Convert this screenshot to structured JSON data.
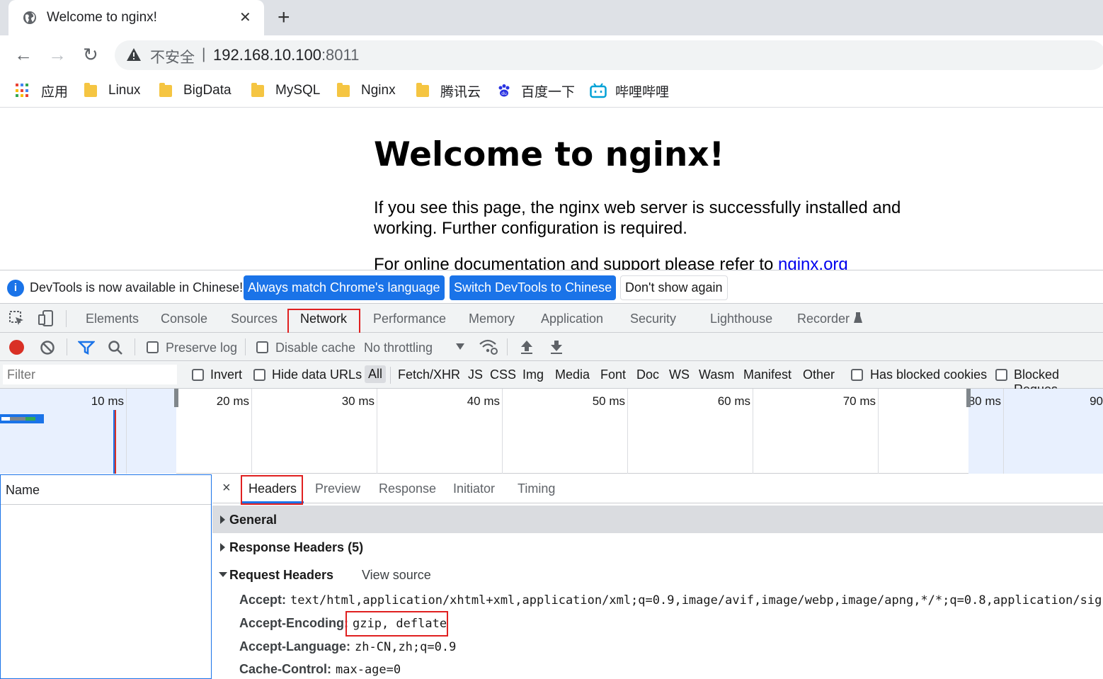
{
  "browser": {
    "tab_title": "Welcome to nginx!",
    "close_glyph": "✕",
    "newtab_glyph": "+",
    "back_glyph": "←",
    "forward_glyph": "→",
    "reload_glyph": "↻",
    "security_label": "不安全",
    "separator": "|",
    "url_host": "192.168.10.100",
    "url_port": ":8011"
  },
  "bookmarks": [
    {
      "label": "应用",
      "icon": "apps-grid-icon"
    },
    {
      "label": "Linux",
      "icon": "folder-icon"
    },
    {
      "label": "BigData",
      "icon": "folder-icon"
    },
    {
      "label": "MySQL",
      "icon": "folder-icon"
    },
    {
      "label": "Nginx",
      "icon": "folder-icon"
    },
    {
      "label": "腾讯云",
      "icon": "folder-icon"
    },
    {
      "label": "百度一下",
      "icon": "baidu-paw-icon"
    },
    {
      "label": "哔哩哔哩",
      "icon": "bilibili-tv-icon"
    }
  ],
  "page": {
    "heading": "Welcome to nginx!",
    "para1": "If you see this page, the nginx web server is successfully installed and working. Further configuration is required.",
    "para2_prefix": "For online documentation and support please refer to ",
    "para2_link": "nginx.org"
  },
  "banner": {
    "info_glyph": "i",
    "message": "DevTools is now available in Chinese!",
    "btn_match": "Always match Chrome's language",
    "btn_switch": "Switch DevTools to Chinese",
    "btn_dismiss": "Don't show again"
  },
  "devtools": {
    "tabs": [
      "Elements",
      "Console",
      "Sources",
      "Network",
      "Performance",
      "Memory",
      "Application",
      "Security",
      "Lighthouse",
      "Recorder"
    ],
    "active_tab": "Network",
    "toolbar": {
      "preserve_log": "Preserve log",
      "disable_cache": "Disable cache",
      "throttling": "No throttling"
    },
    "filter": {
      "placeholder": "Filter",
      "invert": "Invert",
      "hide_data_urls": "Hide data URLs",
      "types": [
        "All",
        "Fetch/XHR",
        "JS",
        "CSS",
        "Img",
        "Media",
        "Font",
        "Doc",
        "WS",
        "Wasm",
        "Manifest",
        "Other"
      ],
      "has_blocked_cookies": "Has blocked cookies",
      "blocked_requests": "Blocked Reques"
    },
    "timeline_ticks": [
      "10 ms",
      "20 ms",
      "30 ms",
      "40 ms",
      "50 ms",
      "60 ms",
      "70 ms",
      "80 ms",
      "90"
    ],
    "name_header": "Name",
    "detail_close": "×",
    "detail_tabs": [
      "Headers",
      "Preview",
      "Response",
      "Initiator",
      "Timing"
    ],
    "sections": {
      "general": "General",
      "response_headers": "Response Headers (5)",
      "request_headers": "Request Headers",
      "view_source": "View source"
    },
    "request_headers": [
      {
        "key": "Accept:",
        "value": "text/html,application/xhtml+xml,application/xml;q=0.9,image/avif,image/webp,image/apng,*/*;q=0.8,application/signed-"
      },
      {
        "key": "Accept-Encoding:",
        "value": "gzip, deflate"
      },
      {
        "key": "Accept-Language:",
        "value": "zh-CN,zh;q=0.9"
      },
      {
        "key": "Cache-Control:",
        "value": "max-age=0"
      }
    ]
  },
  "colors": {
    "accent": "#1a73e8",
    "highlight_box": "#e02020",
    "record": "#d93025"
  }
}
